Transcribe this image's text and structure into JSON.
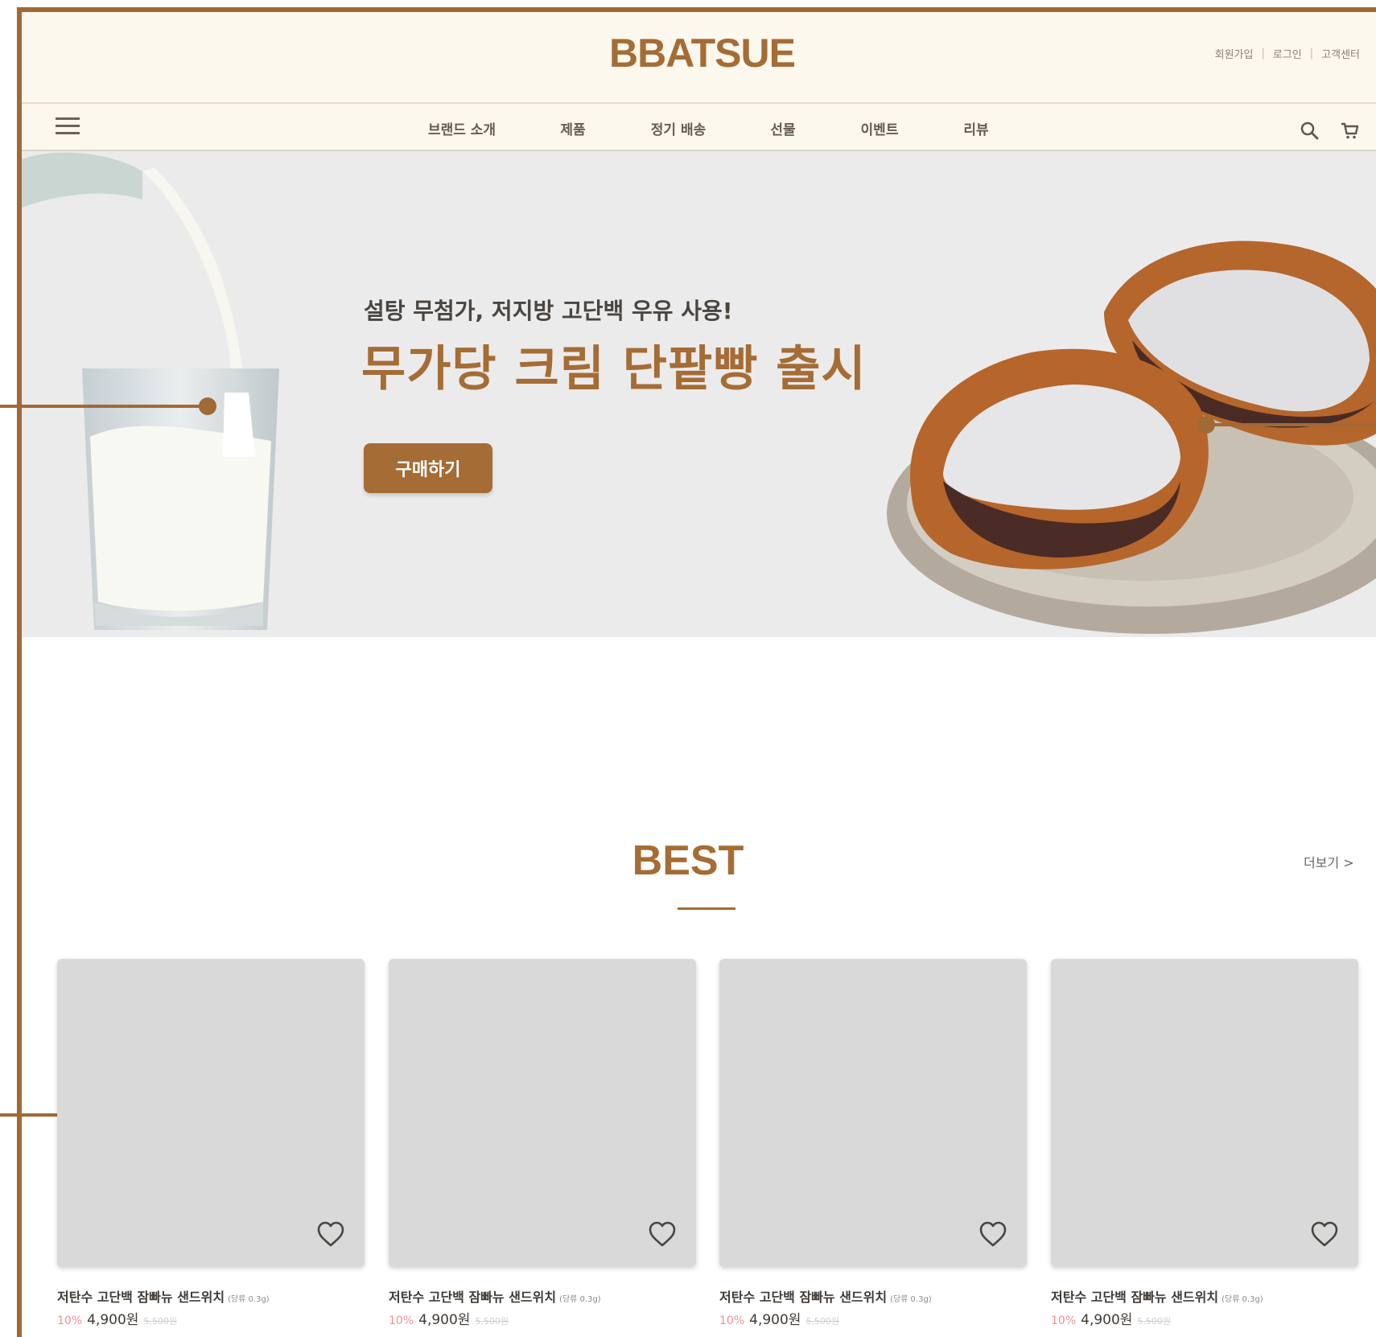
{
  "header": {
    "logo": "BBATSUE",
    "util_links": [
      "회원가입",
      "로그인",
      "고객센터"
    ]
  },
  "nav": {
    "items": [
      "브랜드 소개",
      "제품",
      "정기 배송",
      "선물",
      "이벤트",
      "리뷰"
    ]
  },
  "hero": {
    "subtitle": "설탕 무첨가, 저지방 고단백 우유 사용!",
    "title": "무가당 크림 단팥빵 출시",
    "button_label": "구매하기"
  },
  "best": {
    "title": "BEST",
    "more_label": "더보기 >",
    "products": [
      {
        "name": "저탄수 고단백 잠빠뉴 샌드위치",
        "unit": "(당류 0.3g)",
        "discount": "10%",
        "price": "4,900원",
        "original_price": "5,500원"
      },
      {
        "name": "저탄수 고단백 잠빠뉴 샌드위치",
        "unit": "(당류 0.3g)",
        "discount": "10%",
        "price": "4,900원",
        "original_price": "5,500원"
      },
      {
        "name": "저탄수 고단백 잠빠뉴 샌드위치",
        "unit": "(당류 0.3g)",
        "discount": "10%",
        "price": "4,900원",
        "original_price": "5,500원"
      },
      {
        "name": "저탄수 고단백 잠빠뉴 샌드위치",
        "unit": "(당류 0.3g)",
        "discount": "10%",
        "price": "4,900원",
        "original_price": "5,500원"
      }
    ]
  },
  "colors": {
    "brand": "#a56c35",
    "header_bg": "#fcf8ee",
    "hero_bg": "#ebebeb",
    "card_placeholder": "#d9d9d9",
    "discount": "#ee8f9a"
  },
  "icons": [
    "hamburger-menu-icon",
    "search-icon",
    "cart-icon",
    "heart-icon"
  ]
}
